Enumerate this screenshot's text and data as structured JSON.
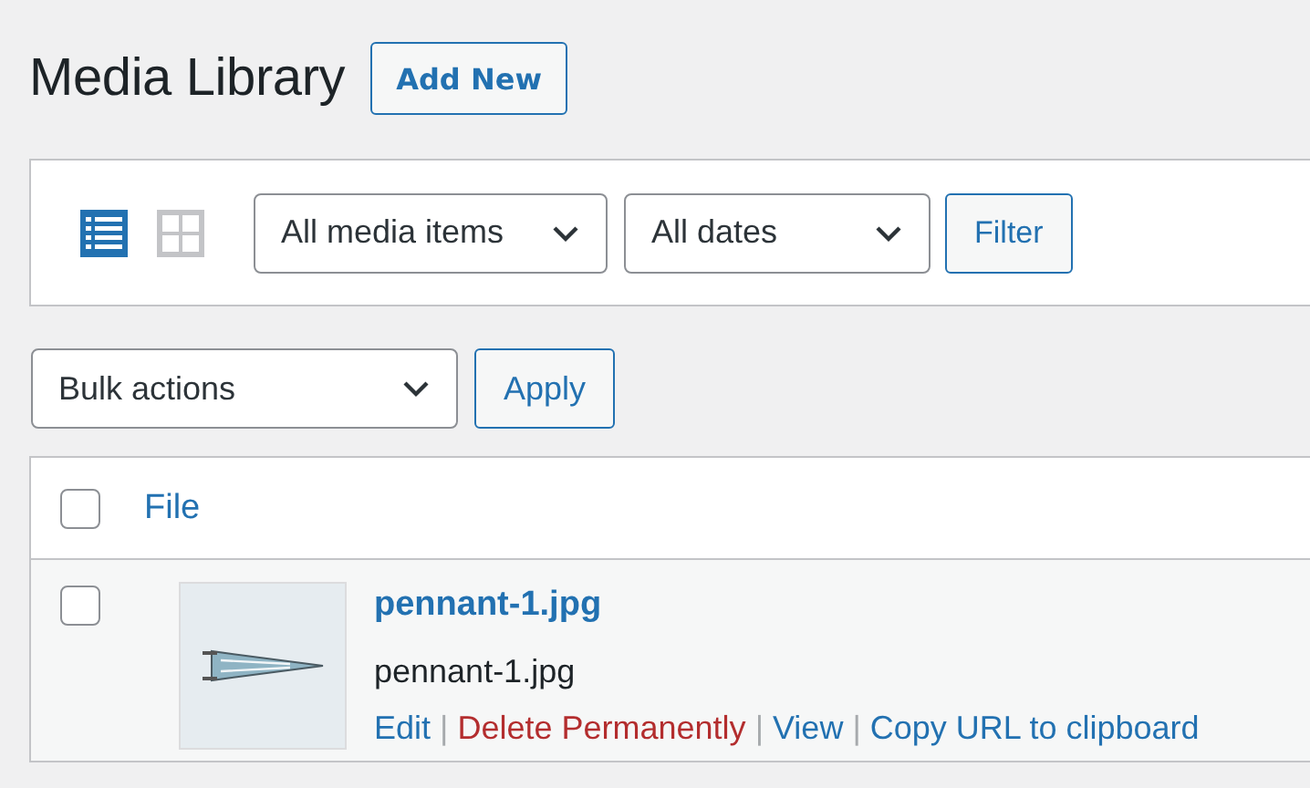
{
  "page": {
    "title": "Media Library",
    "add_new": "Add New"
  },
  "filters": {
    "views": [
      {
        "kind": "list",
        "selected": true
      },
      {
        "kind": "grid",
        "selected": false
      }
    ],
    "type_filter": "All media items",
    "date_filter": "All dates",
    "filter_button": "Filter"
  },
  "bulk": {
    "select": "Bulk actions",
    "apply": "Apply"
  },
  "table": {
    "columns": [
      {
        "label": "File",
        "checked": false
      }
    ],
    "rows": [
      {
        "checked": false,
        "title": "pennant-1.jpg",
        "filename": "pennant-1.jpg",
        "separator": "|",
        "actions": [
          {
            "label": "Edit",
            "kind": "normal"
          },
          {
            "label": "Delete Permanently",
            "kind": "danger"
          },
          {
            "label": "View",
            "kind": "normal"
          },
          {
            "label": "Copy URL to clipboard",
            "kind": "normal"
          }
        ]
      }
    ]
  }
}
